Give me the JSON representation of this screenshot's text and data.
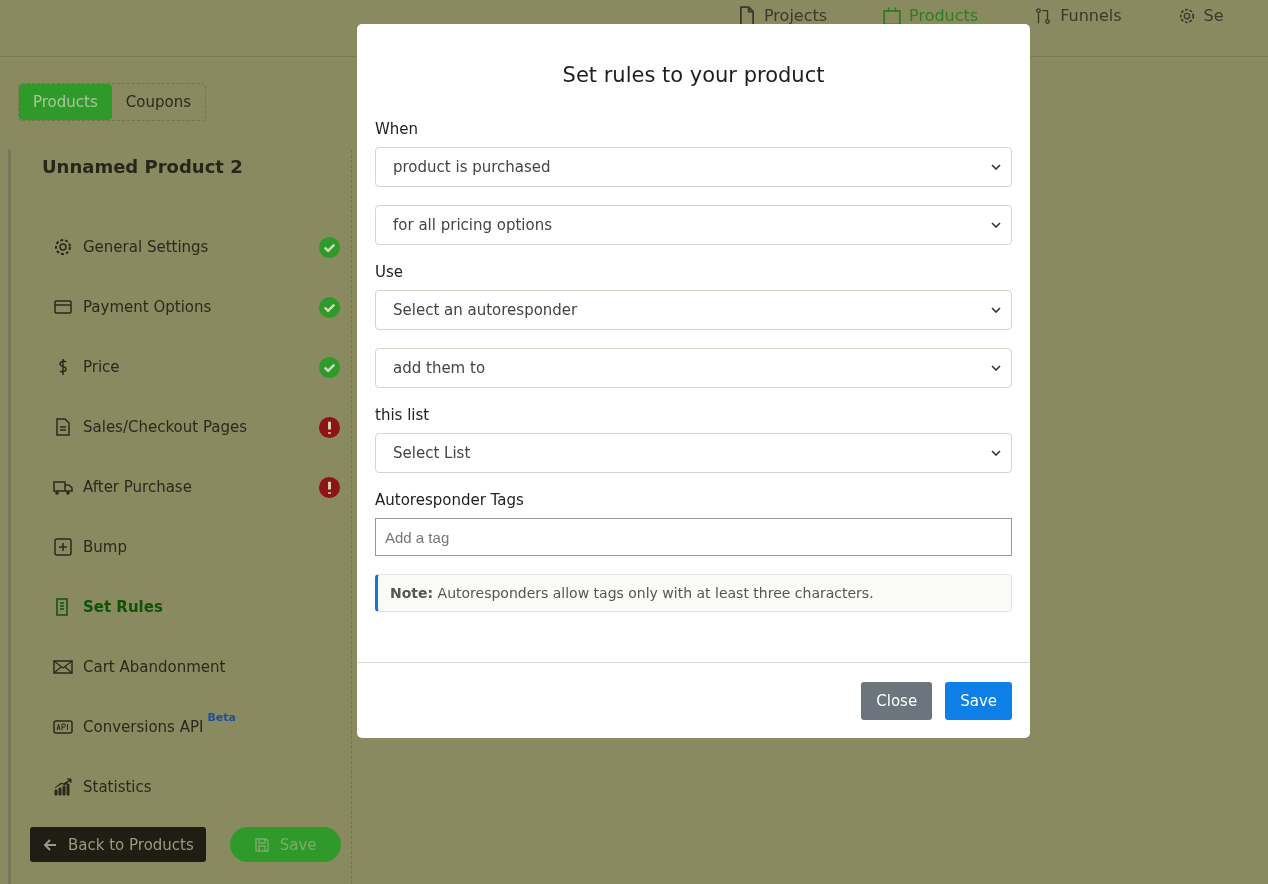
{
  "top_nav": [
    {
      "label": "Projects",
      "selected": false
    },
    {
      "label": "Products",
      "selected": true
    },
    {
      "label": "Funnels",
      "selected": false
    },
    {
      "label": "Se",
      "selected": false
    }
  ],
  "section_tabs": [
    {
      "label": "Products",
      "selected": true
    },
    {
      "label": "Coupons",
      "selected": false
    }
  ],
  "product_title": "Unnamed Product 2",
  "sidebar": {
    "items": [
      {
        "label": "General Settings",
        "kind": "done",
        "selected": false
      },
      {
        "label": "Payment Options",
        "kind": "done",
        "selected": false
      },
      {
        "label": "Price",
        "kind": "done",
        "selected": false
      },
      {
        "label": "Sales/Checkout Pages",
        "kind": "error",
        "selected": false
      },
      {
        "label": "After Purchase",
        "kind": "error",
        "selected": false
      },
      {
        "label": "Bump",
        "selected": false
      },
      {
        "label": "Set Rules",
        "selected": true
      },
      {
        "label": "Cart Abandonment",
        "selected": false
      },
      {
        "label": "Conversions API",
        "badge": "Beta",
        "selected": false
      },
      {
        "label": "Statistics",
        "selected": false
      }
    ]
  },
  "back_button": "Back to Products",
  "save_button": "Save",
  "modal": {
    "title": "Set rules to your product",
    "groups": [
      {
        "label": "When",
        "selects": [
          "product is purchased",
          "for all pricing options"
        ]
      },
      {
        "label": "Use",
        "selects": [
          "Select an autoresponder",
          "add them to"
        ]
      },
      {
        "label": "this list",
        "selects": [
          "Select List"
        ]
      }
    ],
    "tags": {
      "label": "Autoresponder Tags",
      "placeholder": "Add a tag"
    },
    "note": "**Note:** Autoresponders allow tags only with at least three characters.",
    "buttons": [
      {
        "label": "Close",
        "kind": "secondary"
      },
      {
        "label": "Save",
        "kind": "primary"
      }
    ]
  }
}
